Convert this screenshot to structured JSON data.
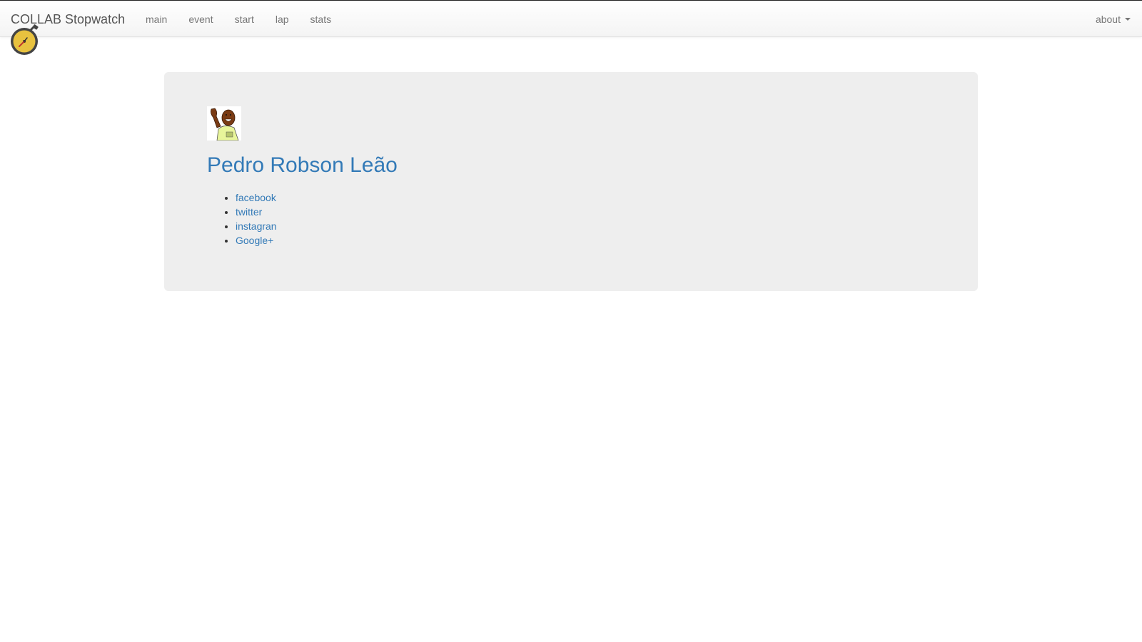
{
  "navbar": {
    "brand": "COLLAB Stopwatch",
    "brand_logo_icon": "stopwatch-icon",
    "links": [
      "main",
      "event",
      "start",
      "lap",
      "stats"
    ],
    "about_label": "about"
  },
  "profile": {
    "avatar_icon": "person-waving-avatar",
    "name": "Pedro Robson Leão",
    "social_links": [
      "facebook",
      "twitter",
      "instagran",
      "Google+"
    ]
  },
  "colors": {
    "link": "#337ab7",
    "jumbotron_bg": "#eeeeee",
    "nav_text": "#777777",
    "stopwatch_face": "#e8c23f",
    "stopwatch_ring": "#444444"
  }
}
